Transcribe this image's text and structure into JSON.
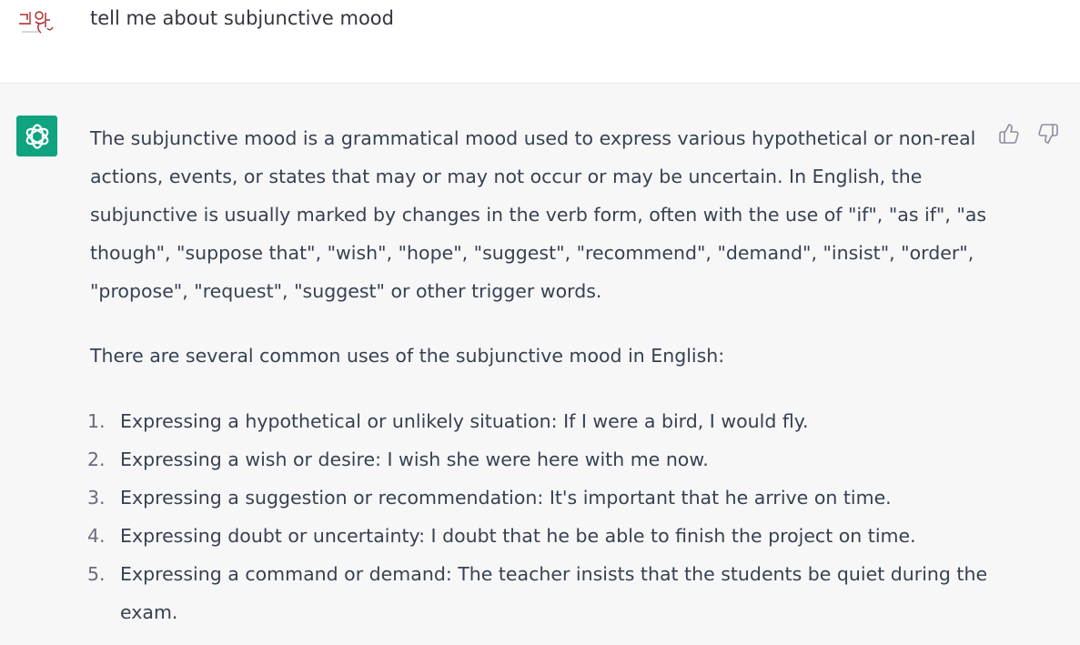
{
  "user_message": {
    "avatar_icon": "user-avatar-logo",
    "text": "tell me about subjunctive mood"
  },
  "assistant_message": {
    "avatar_icon": "openai-logo-icon",
    "avatar_color": "#10a37f",
    "paragraph_1": "The subjunctive mood is a grammatical mood used to express various hypothetical or non-real actions, events, or states that may or may not occur or may be uncertain. In English, the subjunctive is usually marked by changes in the verb form, often with the use of \"if\", \"as if\", \"as though\", \"suppose that\", \"wish\", \"hope\", \"suggest\", \"recommend\", \"demand\", \"insist\", \"order\", \"propose\", \"request\", \"suggest\" or other trigger words.",
    "paragraph_2": "There are several common uses of the subjunctive mood in English:",
    "list": [
      {
        "num": "1.",
        "text": "Expressing a hypothetical or unlikely situation: If I were a bird, I would fly."
      },
      {
        "num": "2.",
        "text": "Expressing a wish or desire: I wish she were here with me now."
      },
      {
        "num": "3.",
        "text": "Expressing a suggestion or recommendation: It's important that he arrive on time."
      },
      {
        "num": "4.",
        "text": "Expressing doubt or uncertainty: I doubt that he be able to finish the project on time."
      },
      {
        "num": "5.",
        "text": "Expressing a command or demand: The teacher insists that the students be quiet during the exam."
      }
    ],
    "feedback": {
      "thumbs_up_icon": "thumbs-up-icon",
      "thumbs_down_icon": "thumbs-down-icon"
    }
  }
}
